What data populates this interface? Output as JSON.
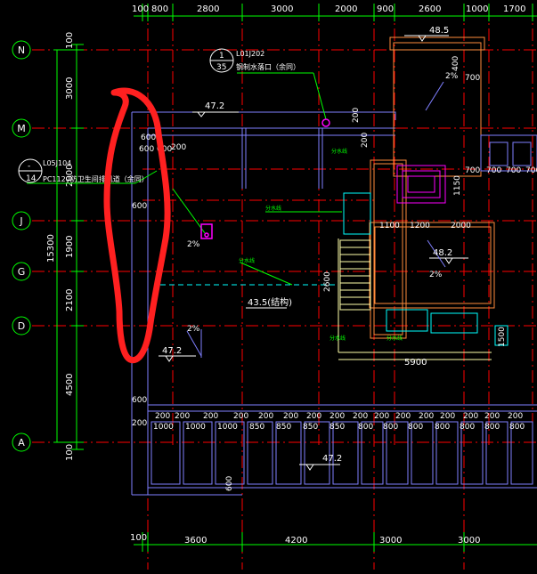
{
  "top_dims": [
    "100",
    "800",
    "2800",
    "3000",
    "2000",
    "900",
    "2600",
    "1000",
    "1700"
  ],
  "bottom_dims": [
    "100",
    "3600",
    "4200",
    "3000",
    "3000"
  ],
  "grid_axes": [
    "N",
    "M",
    "J",
    "G",
    "D",
    "A"
  ],
  "left_dims": [
    "100",
    "3000",
    "2000",
    "1900",
    "2100",
    "4500",
    "100"
  ],
  "left_total": "15300",
  "detail_ref_top": {
    "title": "L01J202",
    "num": "1",
    "sheet": "35",
    "note": "钢制水落口（余同）"
  },
  "detail_ref_left": {
    "title": "L05J104",
    "num": "-",
    "sheet": "14",
    "note": "PC1120防卫生间排风道（余同）"
  },
  "elevations": [
    "47.2",
    "47.2",
    "48.5",
    "48.2",
    "43.5(结构)",
    "47.2"
  ],
  "slopes": [
    "2%",
    "2%",
    "2%",
    "2%"
  ],
  "plan_dims": [
    "600",
    "200",
    "600 600",
    "200",
    "600",
    "200",
    "600",
    "200",
    "1150",
    "700",
    "700",
    "700",
    "700",
    "1100",
    "1200",
    "2000",
    "2600",
    "1500",
    "5900",
    "400",
    "700"
  ],
  "balcony_dims": [
    "200",
    "200",
    "200",
    "200",
    "200",
    "200",
    "200",
    "200",
    "200",
    "200",
    "200",
    "200",
    "200",
    "200",
    "200",
    "200",
    "200",
    "200"
  ],
  "balcony_widths": [
    "1000",
    "1000",
    "1000",
    "850",
    "850",
    "850",
    "850",
    "800",
    "800",
    "800",
    "800",
    "800",
    "800",
    "800"
  ],
  "green_notes": [
    "分水线",
    "分水线",
    "分水线",
    "分水线",
    "分水线"
  ],
  "colors": {
    "background": "#000000",
    "grid": "#ff0000",
    "dimension": "#00ff00",
    "text": "#ffffff",
    "wall": "#7f7fff",
    "highlight": "#ff2020",
    "stair": "#ffffaa",
    "cyan": "#00ffff",
    "orange": "#ff8c3c",
    "magenta": "#ff00ff"
  }
}
